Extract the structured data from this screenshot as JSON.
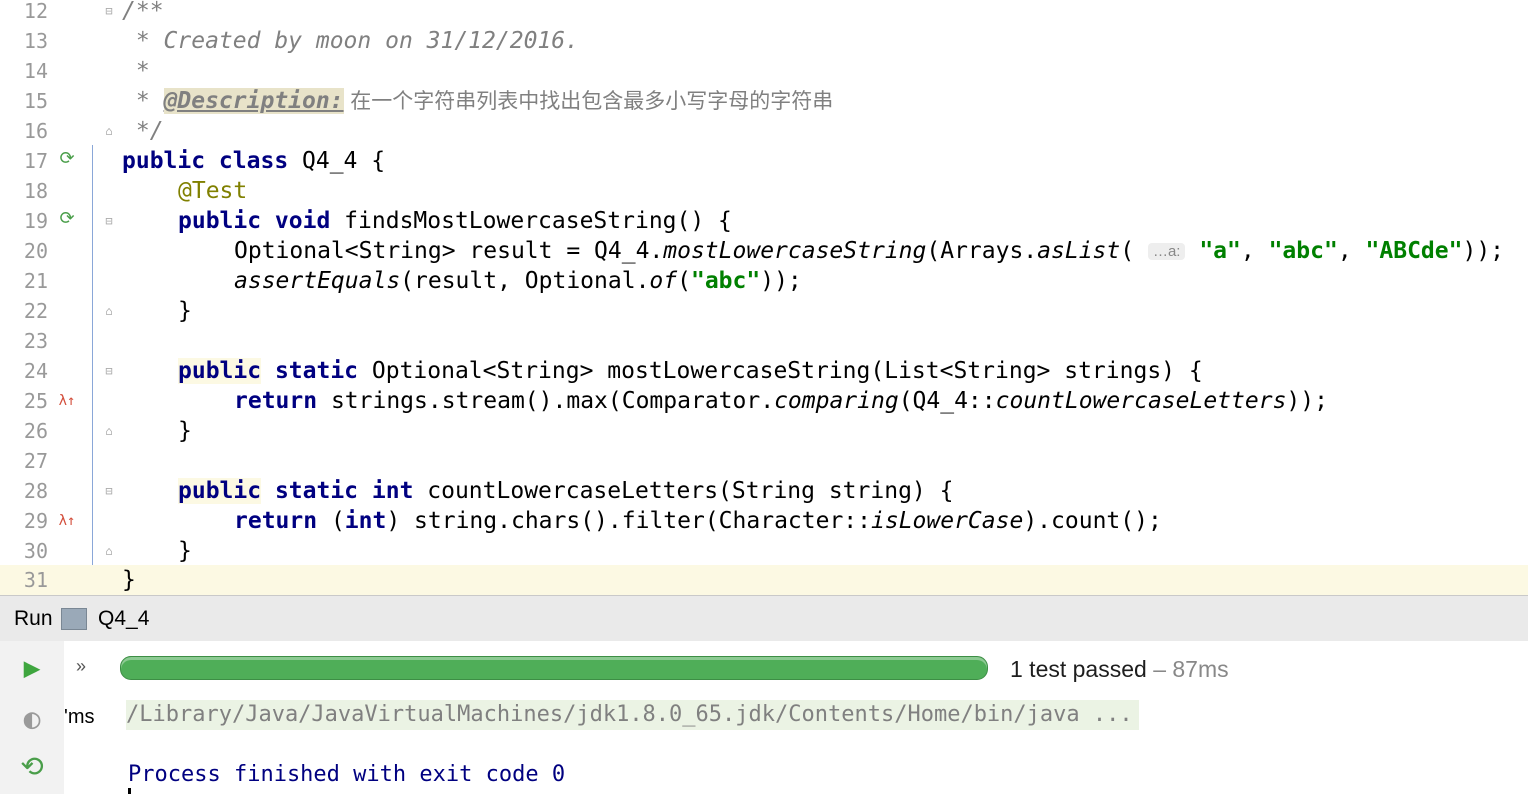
{
  "editor": {
    "line_numbers": [
      "12",
      "13",
      "14",
      "15",
      "16",
      "17",
      "18",
      "19",
      "20",
      "21",
      "22",
      "23",
      "24",
      "25",
      "26",
      "27",
      "28",
      "29",
      "30",
      "31"
    ],
    "lines": {
      "l12": "/**",
      "l13": " * Created by moon on 31/12/2016.",
      "l14": " *",
      "l15_prefix": " * ",
      "l15_tag": "@Description:",
      "l15_text": " 在一个字符串列表中找出包含最多小写字母的字符串",
      "l16": " */",
      "l17_kw": "public class",
      "l17_rest": " Q4_4 {",
      "l18": "@Test",
      "l19_kw": "public void",
      "l19_rest": " findsMostLowercaseString() {",
      "l20_a": "Optional<String> result = Q4_4.",
      "l20_b": "mostLowercaseString",
      "l20_c": "(Arrays.",
      "l20_d": "asList",
      "l20_e": "( ",
      "l20_hint": "…a:",
      "l20_s1": "\"a\"",
      "l20_sep1": ", ",
      "l20_s2": "\"abc\"",
      "l20_sep2": ", ",
      "l20_s3": "\"ABCde\"",
      "l20_end": "));",
      "l21_a": "assertEquals",
      "l21_b": "(result, Optional.",
      "l21_c": "of",
      "l21_d": "(",
      "l21_s": "\"abc\"",
      "l21_e": "));",
      "l22": "}",
      "l24_kw1": "public",
      "l24_kw2": " static",
      "l24_rest": " Optional<String> mostLowercaseString(List<String> strings) {",
      "l25_kw": "return",
      "l25_a": " strings.stream().max(Comparator.",
      "l25_b": "comparing",
      "l25_c": "(Q4_4::",
      "l25_d": "countLowercaseLetters",
      "l25_e": "));",
      "l26": "}",
      "l28_kw1": "public",
      "l28_kw2": " static int",
      "l28_rest": " countLowercaseLetters(String string) {",
      "l29_kw": "return",
      "l29_a": " (",
      "l29_kw2": "int",
      "l29_b": ") string.chars().filter(Character::",
      "l29_c": "isLowerCase",
      "l29_d": ").count();",
      "l30": "}",
      "l31": "}"
    },
    "gutter_icons": {
      "run_class": "run-test-icon",
      "run_method": "run-test-icon",
      "lambda": "lambda-icon"
    }
  },
  "run_panel": {
    "label": "Run",
    "tab": "Q4_4",
    "expand_label": "»",
    "tree_item": "'ms",
    "progress_fraction": 1.0,
    "status": "1 test passed",
    "status_time": " – 87ms",
    "command": "/Library/Java/JavaVirtualMachines/jdk1.8.0_65.jdk/Contents/Home/bin/java ...",
    "exit_message": "Process finished with exit code 0",
    "colors": {
      "progress": "#4fae58",
      "accent_play": "#3fa63f"
    }
  }
}
